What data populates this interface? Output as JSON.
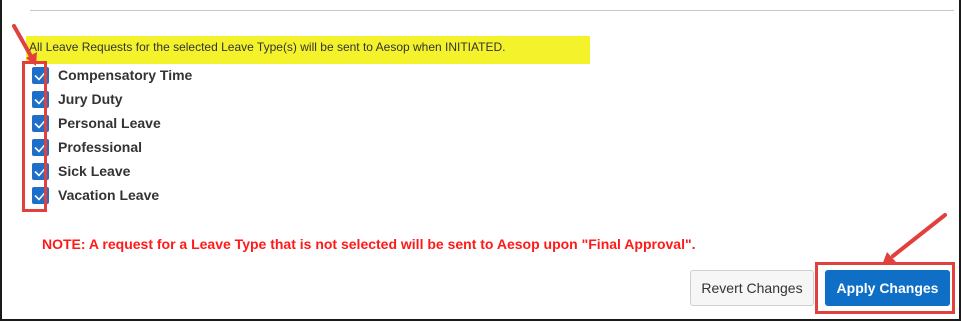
{
  "info_banner": "All Leave Requests for the selected Leave Type(s) will be sent to Aesop when INITIATED.",
  "leave_types": [
    {
      "label": "Compensatory Time",
      "checked": true
    },
    {
      "label": "Jury Duty",
      "checked": true
    },
    {
      "label": "Personal Leave",
      "checked": true
    },
    {
      "label": "Professional",
      "checked": true
    },
    {
      "label": "Sick Leave",
      "checked": true
    },
    {
      "label": "Vacation Leave",
      "checked": true
    }
  ],
  "note": "NOTE: A request for a Leave Type that is not selected will be sent to Aesop upon \"Final Approval\".",
  "buttons": {
    "revert_label": "Revert Changes",
    "apply_label": "Apply Changes"
  },
  "colors": {
    "banner_highlight": "#f4f32b",
    "checkbox_blue": "#1d6fc9",
    "note_red": "#ff1a1a",
    "annotation_red": "#e2403c",
    "apply_blue": "#0f6fc7"
  }
}
